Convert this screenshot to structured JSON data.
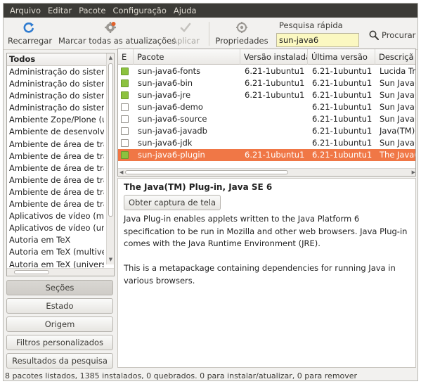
{
  "menubar": {
    "items": [
      "Arquivo",
      "Editar",
      "Pacote",
      "Configuração",
      "Ajuda"
    ]
  },
  "toolbar": {
    "reload_label": "Recarregar",
    "mark_all_label": "Marcar todas as atualizações",
    "apply_label": "Aplicar",
    "properties_label": "Propriedades",
    "quick_search_label": "Pesquisa rápida",
    "quick_search_value": "sun-java6",
    "search_label": "Procurar"
  },
  "sidebar": {
    "header": "Todos",
    "items": [
      "Administração do sistema",
      "Administração do sistema",
      "Administração do sistema",
      "Administração do sistema",
      "Ambiente Zope/Plone (univ",
      "Ambiente de desenvolvime",
      "Ambiente de área de traba",
      "Ambiente de área de traba",
      "Ambiente de área de traba",
      "Ambiente de área de traba",
      "Ambiente de área de traba",
      "Ambiente de área de traba",
      "Aplicativos de vídeo (multi",
      "Aplicativos de vídeo (unive",
      "Autoria em TeX",
      "Autoria em TeX (multiverse",
      "Autoria em TeX (universe)"
    ],
    "filters": [
      "Seções",
      "Estado",
      "Origem",
      "Filtros personalizados",
      "Resultados da pesquisa"
    ]
  },
  "packages": {
    "columns": [
      "E",
      "Pacote",
      "Versão instalada",
      "Última versão",
      "Descriçã"
    ],
    "rows": [
      {
        "installed": true,
        "name": "sun-java6-fonts",
        "installed_version": "6.21-1ubuntu1",
        "latest_version": "6.21-1ubuntu1",
        "description": "Lucida Tru"
      },
      {
        "installed": true,
        "name": "sun-java6-bin",
        "installed_version": "6.21-1ubuntu1",
        "latest_version": "6.21-1ubuntu1",
        "description": "Sun Java(T"
      },
      {
        "installed": true,
        "name": "sun-java6-jre",
        "installed_version": "6.21-1ubuntu1",
        "latest_version": "6.21-1ubuntu1",
        "description": "Sun Java(T"
      },
      {
        "installed": false,
        "name": "sun-java6-demo",
        "installed_version": "",
        "latest_version": "6.21-1ubuntu1",
        "description": "Sun Java(T"
      },
      {
        "installed": false,
        "name": "sun-java6-source",
        "installed_version": "",
        "latest_version": "6.21-1ubuntu1",
        "description": "Sun Java(T"
      },
      {
        "installed": false,
        "name": "sun-java6-javadb",
        "installed_version": "",
        "latest_version": "6.21-1ubuntu1",
        "description": "Java(TM) D"
      },
      {
        "installed": false,
        "name": "sun-java6-jdk",
        "installed_version": "",
        "latest_version": "6.21-1ubuntu1",
        "description": "Sun Java(T"
      },
      {
        "installed": true,
        "selected": true,
        "name": "sun-java6-plugin",
        "installed_version": "6.21-1ubuntu1",
        "latest_version": "6.21-1ubuntu1",
        "description": "The Java(T"
      }
    ]
  },
  "details": {
    "title": "The Java(TM) Plug-in, Java SE 6",
    "screenshot_button": "Obter captura de tela",
    "paragraphs": [
      "Java Plug-in enables applets written to the Java Platform 6 specification to be run in Mozilla and other web browsers. Java Plug-in comes with the Java Runtime Environment (JRE).",
      "This is a metapackage containing dependencies for running Java in various browsers."
    ]
  },
  "statusbar": {
    "text": "8 pacotes listados, 1385 instalados, 0 quebrados. 0 para instalar/atualizar, 0 para remover"
  },
  "colors": {
    "menubar_bg": "#3c3b37",
    "selection": "#f07746",
    "installed_checkbox": "#8cc23f",
    "search_field": "#fbf8c1"
  }
}
